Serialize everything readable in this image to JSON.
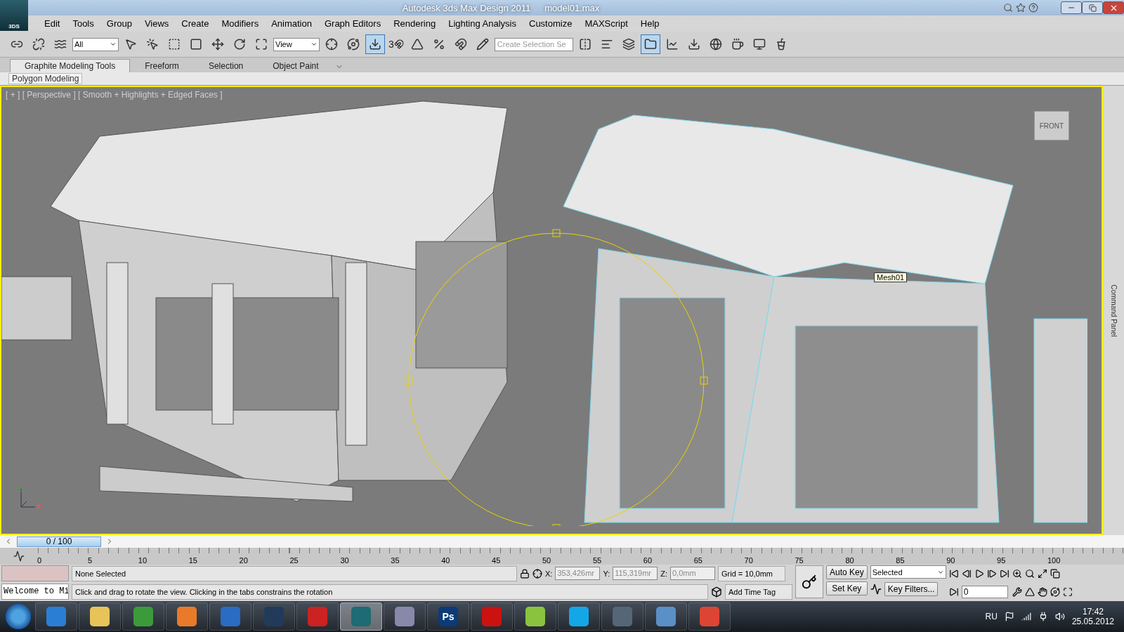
{
  "window": {
    "title": "Autodesk 3ds Max Design 2011",
    "file": "model01.max",
    "app_badge": "3DS"
  },
  "menu": [
    "Edit",
    "Tools",
    "Group",
    "Views",
    "Create",
    "Modifiers",
    "Animation",
    "Graph Editors",
    "Rendering",
    "Lighting Analysis",
    "Customize",
    "MAXScript",
    "Help"
  ],
  "toolbar": {
    "selection_filter": "All",
    "reference_coords": "View",
    "snap_label": "3",
    "named_selection": {
      "placeholder": "Create Selection Se"
    }
  },
  "ribbon": {
    "tabs": [
      {
        "label": "Graphite Modeling Tools",
        "selected": true
      },
      {
        "label": "Freeform",
        "selected": false
      },
      {
        "label": "Selection",
        "selected": false
      },
      {
        "label": "Object Paint",
        "selected": false
      }
    ],
    "panel": "Polygon Modeling"
  },
  "viewport": {
    "label": "[ + ] [ Perspective ] [ Smooth + Highlights + Edged Faces ]",
    "tooltip": "Mesh01",
    "viewcube": "FRONT",
    "axes": [
      "z",
      "x"
    ],
    "side_label": "Command Panel"
  },
  "time_slider": {
    "label": "0 / 100",
    "level": 0.0
  },
  "ruler": [
    "0",
    "5",
    "10",
    "15",
    "20",
    "25",
    "30",
    "35",
    "40",
    "45",
    "50",
    "55",
    "60",
    "65",
    "70",
    "75",
    "80",
    "85",
    "90",
    "95",
    "100"
  ],
  "status": {
    "listener": "Welcome to Mi",
    "selection": "None Selected",
    "prompt": "Click and drag to rotate the view.  Clicking in the tabs constrains the rotation",
    "x_label": "X:",
    "x": "353,426mr",
    "y_label": "Y:",
    "y": "115,319mr",
    "z_label": "Z:",
    "z": "0,0mm",
    "grid": "Grid = 10,0mm",
    "time_tag": "Add Time Tag",
    "auto_key": "Auto Key",
    "set_key": "Set Key",
    "key_mode": "Selected",
    "key_filters": "Key Filters...",
    "frame": "0"
  },
  "taskbar": {
    "apps": [
      {
        "kind": "browser",
        "selected": false
      },
      {
        "kind": "folder",
        "selected": false
      },
      {
        "kind": "torrent",
        "selected": false
      },
      {
        "kind": "player",
        "selected": false
      },
      {
        "kind": "music",
        "selected": false
      },
      {
        "kind": "cad",
        "selected": false
      },
      {
        "kind": "autocad",
        "selected": false
      },
      {
        "kind": "max",
        "selected": true
      },
      {
        "kind": "window",
        "selected": false
      },
      {
        "kind": "ps",
        "selected": false
      },
      {
        "kind": "pdf",
        "selected": false
      },
      {
        "kind": "corel",
        "selected": false
      },
      {
        "kind": "skype",
        "selected": false
      },
      {
        "kind": "monitor",
        "selected": false
      },
      {
        "kind": "photo",
        "selected": false
      },
      {
        "kind": "chrome",
        "selected": false
      }
    ],
    "ps_label": "Ps",
    "language": "RU",
    "time": "17:42",
    "date": "25.05.2012"
  }
}
